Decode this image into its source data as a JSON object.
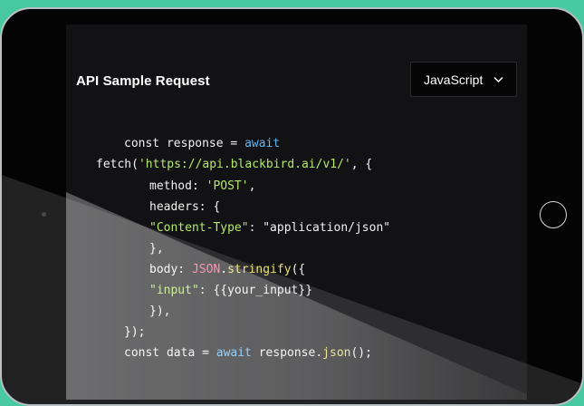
{
  "panel": {
    "title": "API Sample Request"
  },
  "language_select": {
    "selected": "JavaScript"
  },
  "code_lines": [
    [
      {
        "t": "const response = ",
        "c": ""
      },
      {
        "t": "await",
        "c": "kw"
      }
    ],
    [
      {
        "t": "fetch(",
        "c": ""
      },
      {
        "t": "'https://api.blackbird.ai/v1/'",
        "c": "str"
      },
      {
        "t": ", {",
        "c": ""
      }
    ],
    [
      {
        "t": "method: ",
        "c": ""
      },
      {
        "t": "'POST'",
        "c": "str"
      },
      {
        "t": ",",
        "c": ""
      }
    ],
    [
      {
        "t": "headers: {",
        "c": ""
      }
    ],
    [
      {
        "t": "\"Content-Type\"",
        "c": "str"
      },
      {
        "t": ": \"application/json\"",
        "c": ""
      }
    ],
    [
      {
        "t": "},",
        "c": ""
      }
    ],
    [
      {
        "t": "body: ",
        "c": ""
      },
      {
        "t": "JSON",
        "c": "obj"
      },
      {
        "t": ".",
        "c": ""
      },
      {
        "t": "stringify",
        "c": "fn"
      },
      {
        "t": "({",
        "c": ""
      }
    ],
    [
      {
        "t": "\"input\"",
        "c": "str"
      },
      {
        "t": ": {{your_input}}",
        "c": ""
      }
    ],
    [
      {
        "t": "}),",
        "c": ""
      }
    ],
    [
      {
        "t": "});",
        "c": ""
      }
    ],
    [
      {
        "t": "const data = ",
        "c": ""
      },
      {
        "t": "await",
        "c": "kw"
      },
      {
        "t": " response.",
        "c": ""
      },
      {
        "t": "json",
        "c": "fn"
      },
      {
        "t": "();",
        "c": ""
      }
    ]
  ],
  "colors": {
    "background": "#48c9a0",
    "keyword": "#5fb8f5",
    "string": "#b4e86a",
    "function": "#e8df6a",
    "object": "#ff5a8a"
  }
}
